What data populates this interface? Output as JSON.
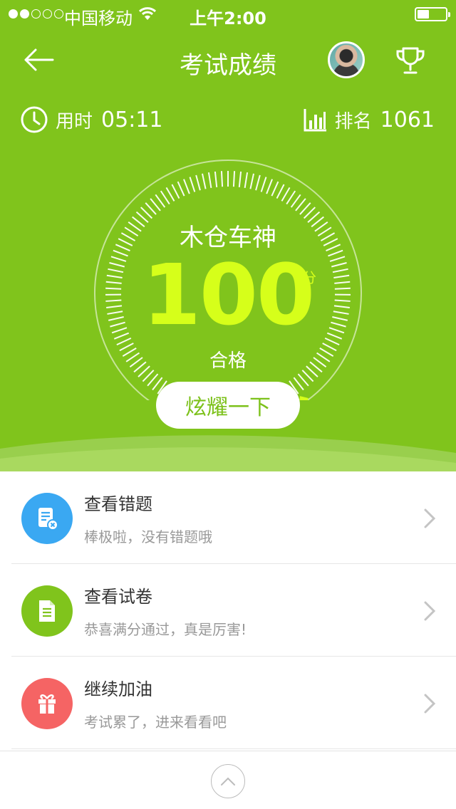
{
  "status_bar": {
    "carrier": "中国移动",
    "time": "上午2:00"
  },
  "nav": {
    "title": "考试成绩"
  },
  "stats": {
    "time_label": "用时",
    "time_value": "05:11",
    "rank_label": "排名",
    "rank_value": "1061"
  },
  "result": {
    "title": "木仓车神",
    "score": "100",
    "unit": "分",
    "status": "合格",
    "gauge_fraction": 1.0
  },
  "share_button": "炫耀一下",
  "list": [
    {
      "title": "查看错题",
      "subtitle": "棒极啦，没有错题哦",
      "icon": "wrong-questions-icon",
      "color": "#3aa8f2"
    },
    {
      "title": "查看试卷",
      "subtitle": "恭喜满分通过，真是厉害!",
      "icon": "document-icon",
      "color": "#80c41c"
    },
    {
      "title": "继续加油",
      "subtitle": "考试累了，进来看看吧",
      "icon": "gift-icon",
      "color": "#f56464"
    }
  ],
  "colors": {
    "hero_green": "#80c41c",
    "score_yellow": "#d6ff1a"
  }
}
